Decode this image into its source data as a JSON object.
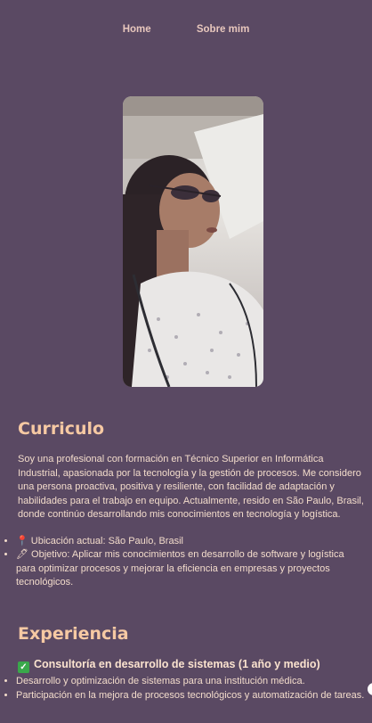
{
  "nav": {
    "home": "Home",
    "sobre": "Sobre mim"
  },
  "curriculo": {
    "title": "Curriculo",
    "intro": "Soy una profesional con formación en Técnico Superior en Informática Industrial, apasionada por la tecnología y la gestión de procesos. Me considero una persona proactiva, positiva y resiliente, con facilidad de adaptación y habilidades para el trabajo en equipo. Actualmente, resido en São Paulo, Brasil, donde continúo desarrollando mis conocimientos en tecnología y logística.",
    "items": [
      {
        "icon": "pin-icon",
        "text": "Ubicación actual: São Paulo, Brasil"
      },
      {
        "icon": "pencil-icon",
        "text": "Objetivo: Aplicar mis conocimientos en desarrollo de software y logística para optimizar procesos y mejorar la eficiencia en empresas y proyectos tecnológicos."
      }
    ]
  },
  "experiencia": {
    "title": "Experiencia",
    "job_title": "Consultoría en desarrollo de sistemas (1 año y medio)",
    "bullets": [
      "Desarrollo y optimización de sistemas para una institución médica.",
      "Participación en la mejora de procesos tecnológicos y automatización de tareas."
    ]
  },
  "colors": {
    "background": "#5a4963",
    "heading": "#f6c9a3",
    "text": "#f3dccb"
  }
}
